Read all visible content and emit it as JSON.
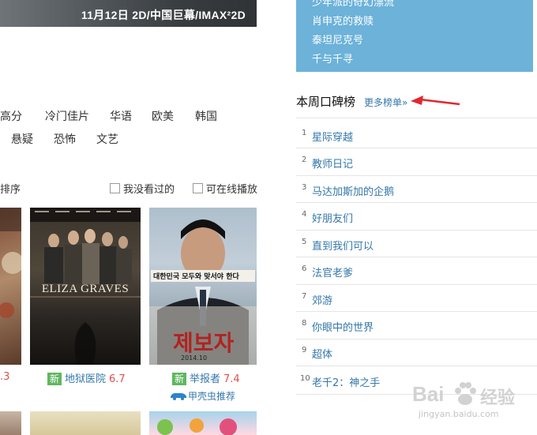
{
  "banner": {
    "text": "11月12日 2D/中国巨幕/IMAX²2D"
  },
  "filters": {
    "row1": [
      "高分",
      "冷门佳片",
      "华语",
      "欧美",
      "韩国"
    ],
    "row2": [
      "悬疑",
      "恐怖",
      "文艺"
    ]
  },
  "sortbar": {
    "sort_label": "排序",
    "not_seen_label": "我没看过的",
    "online_label": "可在线播放"
  },
  "posters": [
    {
      "partial_rating": ".3"
    },
    {
      "badge": "新",
      "title": "地狱医院",
      "rating": "6.7",
      "image_title": "ELIZA GRAVES"
    },
    {
      "badge": "新",
      "title": "举报者",
      "rating": "7.4",
      "recommend": "甲壳虫推荐",
      "image_title": "제보자",
      "image_tagline": "대한민국 모두와 맞서야 한다",
      "image_date": "2014.10"
    }
  ],
  "sidebar": {
    "blue_items": [
      "少年派的奇幻漂流",
      "肖申克的救赎",
      "泰坦尼克号",
      "千与千寻"
    ],
    "weekly_title": "本周口碑榜",
    "more_link": "更多榜单»",
    "ranking": [
      {
        "num": "1",
        "name": "星际穿越"
      },
      {
        "num": "2",
        "name": "教师日记"
      },
      {
        "num": "3",
        "name": "马达加斯加的企鹅"
      },
      {
        "num": "4",
        "name": "好朋友们"
      },
      {
        "num": "5",
        "name": "直到我们可以"
      },
      {
        "num": "6",
        "name": "法官老爹"
      },
      {
        "num": "7",
        "name": "郊游"
      },
      {
        "num": "8",
        "name": "你眼中的世界"
      },
      {
        "num": "9",
        "name": "超体"
      },
      {
        "num": "10",
        "name": "老千2：神之手"
      }
    ]
  },
  "watermark": {
    "brand": "Bai",
    "brand2": "经验",
    "url": "jingyan.baidu.com"
  },
  "colors": {
    "link": "#3377aa",
    "blue_box": "#6cb2d9",
    "arrow": "#e0282e",
    "new_badge": "#5fb760"
  }
}
